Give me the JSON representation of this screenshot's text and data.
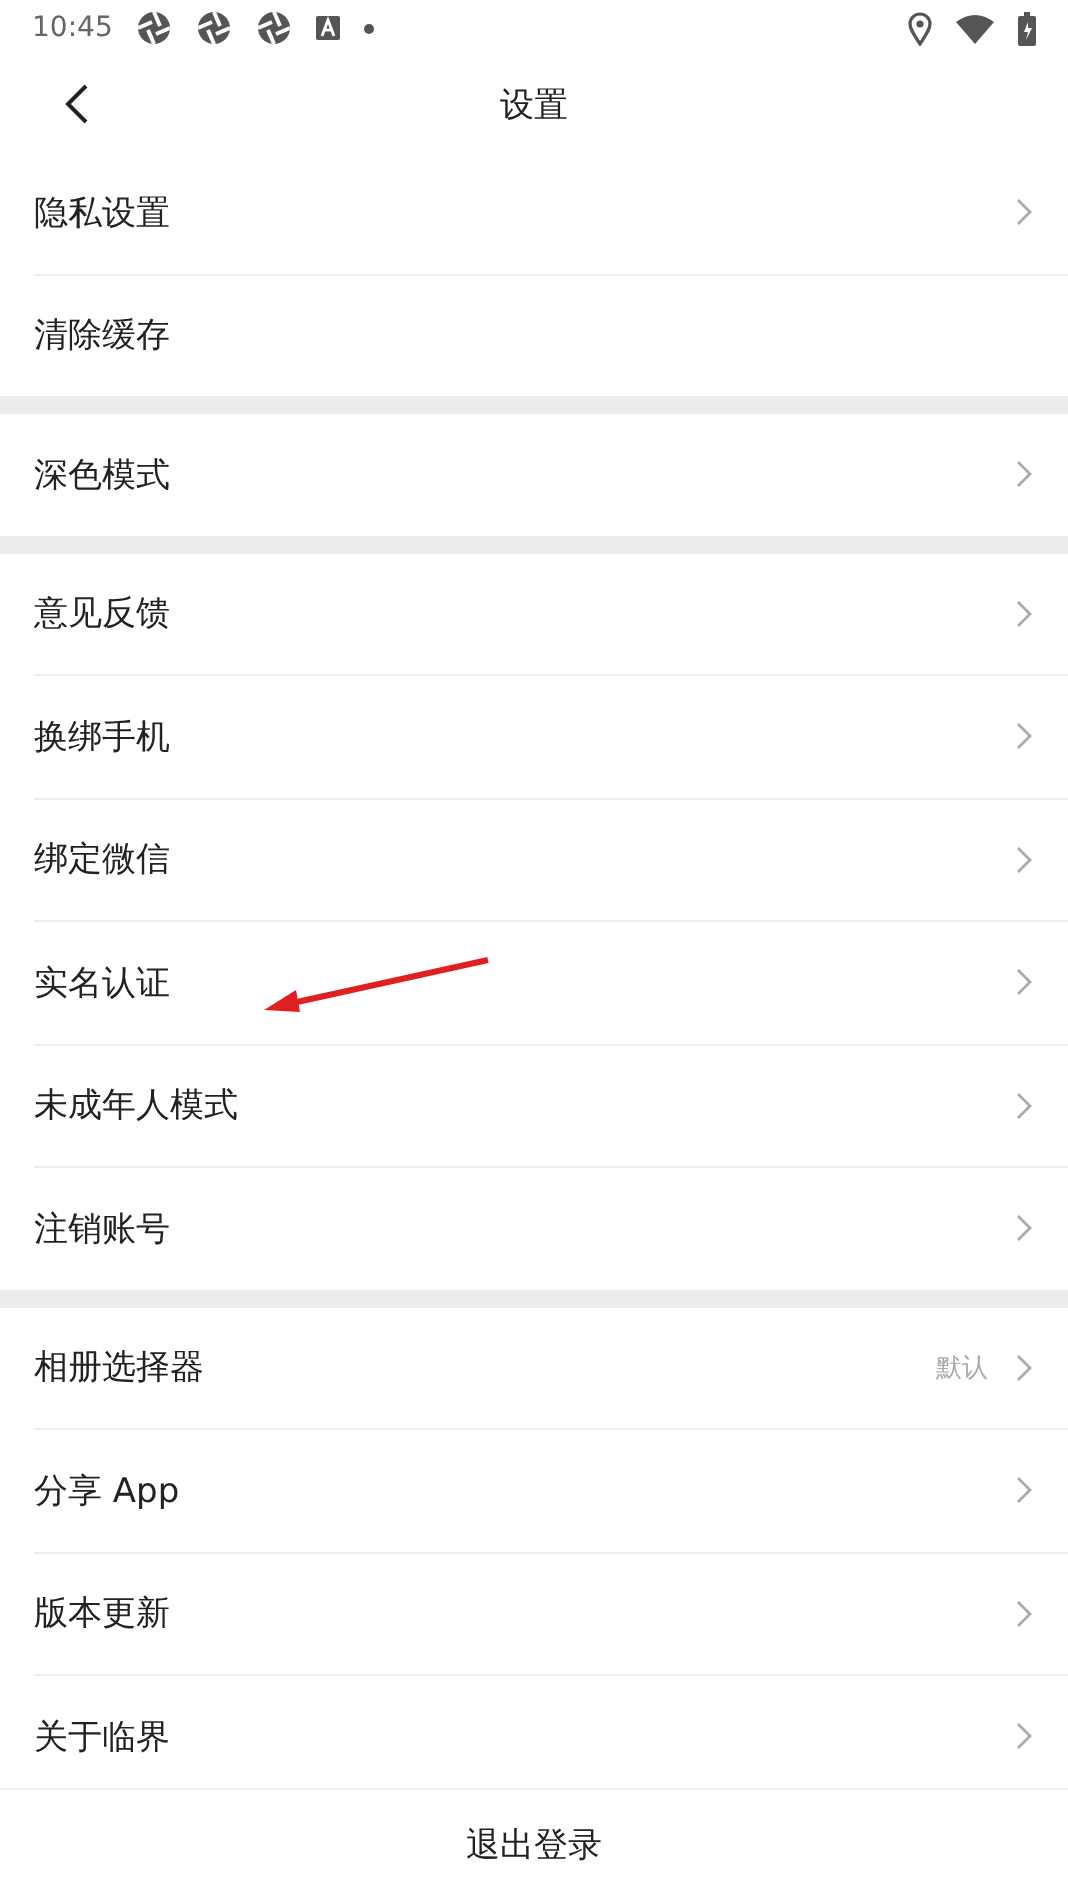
{
  "status_bar": {
    "time": "10:45"
  },
  "header": {
    "title": "设置"
  },
  "sections": [
    {
      "items": [
        {
          "label": "隐私设置",
          "chevron": true
        },
        {
          "label": "清除缓存",
          "chevron": false
        }
      ]
    },
    {
      "items": [
        {
          "label": "深色模式",
          "chevron": true
        }
      ]
    },
    {
      "items": [
        {
          "label": "意见反馈",
          "chevron": true
        },
        {
          "label": "换绑手机",
          "chevron": true
        },
        {
          "label": "绑定微信",
          "chevron": true
        },
        {
          "label": "实名认证",
          "chevron": true
        },
        {
          "label": "未成年人模式",
          "chevron": true
        },
        {
          "label": "注销账号",
          "chevron": true
        }
      ]
    },
    {
      "items": [
        {
          "label": "相册选择器",
          "value": "默认",
          "chevron": true
        },
        {
          "label": "分享 App",
          "chevron": true
        },
        {
          "label": "版本更新",
          "chevron": true
        },
        {
          "label": "关于临界",
          "chevron": true
        }
      ]
    }
  ],
  "logout_button": "退出登录"
}
